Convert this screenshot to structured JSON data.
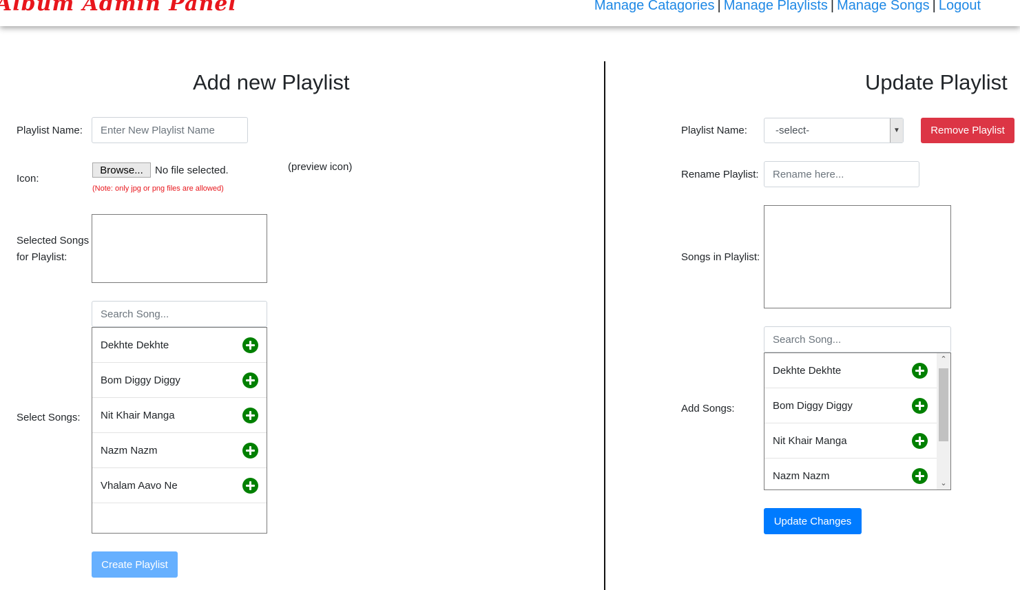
{
  "header": {
    "brand": "Album Admin Panel",
    "nav": [
      "Manage Catagories",
      "Manage Playlists",
      "Manage Songs",
      "Logout"
    ],
    "separator": "|"
  },
  "add_playlist": {
    "title": "Add new Playlist",
    "name_label": "Playlist Name:",
    "name_placeholder": "Enter New Playlist Name",
    "icon_label": "Icon:",
    "browse_label": "Browse...",
    "no_file_text": "No file selected.",
    "note": "(Note: only jpg or png files are allowed)",
    "preview_text": "(preview icon)",
    "selected_songs_label": "Selected Songs for Playlist:",
    "select_songs_label": "Select Songs:",
    "search_placeholder": "Search Song...",
    "songs": [
      "Dekhte Dekhte",
      "Bom Diggy Diggy",
      "Nit Khair Manga",
      "Nazm Nazm",
      "Vhalam Aavo Ne"
    ],
    "create_button": "Create Playlist"
  },
  "update_playlist": {
    "title": "Update Playlist",
    "name_label": "Playlist Name:",
    "select_value": "-select-",
    "remove_button": "Remove Playlist",
    "rename_label": "Rename Playlist:",
    "rename_placeholder": "Rename here...",
    "songs_in_playlist_label": "Songs in Playlist:",
    "add_songs_label": "Add Songs:",
    "search_placeholder": "Search Song...",
    "songs": [
      "Dekhte Dekhte",
      "Bom Diggy Diggy",
      "Nit Khair Manga",
      "Nazm Nazm"
    ],
    "update_button": "Update Changes"
  },
  "icons": {
    "add": "plus-circle-icon",
    "dropdown": "chevron-down-icon",
    "scroll_up": "chevron-up-icon",
    "scroll_down": "chevron-down-icon"
  },
  "colors": {
    "brand": "#e8161c",
    "link": "#1e88e5",
    "add_icon": "#008000",
    "create_button": "#66b0ff",
    "remove_button": "#dc3545",
    "update_button": "#007bff"
  }
}
